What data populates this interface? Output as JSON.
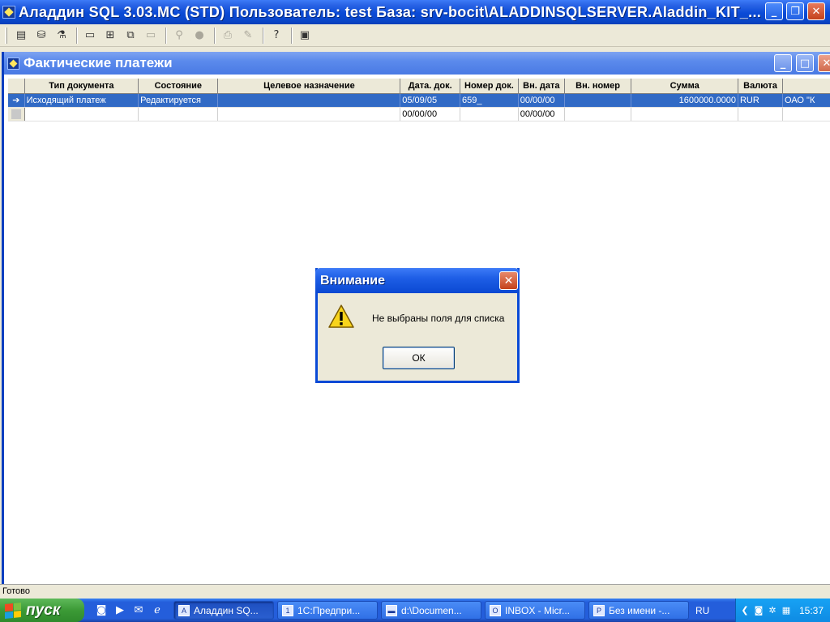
{
  "window": {
    "title": "Аладдин SQL 3.03.МС (STD)  Пользователь: test База: srv-bocit\\ALADDINSQLSERVER.Aladdin_KIT_..."
  },
  "toolbar": {
    "icons": [
      "document-list-icon",
      "database-icon",
      "filter-icon",
      "window-icon",
      "tile-icon",
      "cascade-icon",
      "window-gray-icon",
      "binoculars-icon",
      "stamp-icon",
      "printer-icon",
      "tools-icon",
      "help-icon",
      "exit-icon"
    ]
  },
  "child": {
    "title": "Фактические платежи"
  },
  "grid": {
    "columns": [
      "Тип документа",
      "Состояние",
      "Целевое назначение",
      "Дата. док.",
      "Номер док.",
      "Вн. дата",
      "Вн. номер",
      "Сумма",
      "Валюта",
      ""
    ],
    "rows": [
      {
        "type": "Исходящий платеж",
        "state": "Редактируется",
        "purpose": "",
        "doc_date": "05/09/05",
        "doc_num": "659_",
        "in_date": "00/00/00",
        "in_num": "",
        "sum": "1600000.0000",
        "currency": "RUR",
        "extra": "ОАО \"К"
      },
      {
        "type": "",
        "state": "",
        "purpose": "",
        "doc_date": "00/00/00",
        "doc_num": "",
        "in_date": "00/00/00",
        "in_num": "",
        "sum": "",
        "currency": "",
        "extra": ""
      }
    ]
  },
  "dialog": {
    "title": "Внимание",
    "message": "Не выбраны поля для списка",
    "ok": "ОК"
  },
  "status": {
    "text": "Готово"
  },
  "taskbar": {
    "start": "пуск",
    "tasks": [
      "Аладдин SQ...",
      "1С:Предпри...",
      "d:\\Documen...",
      "INBOX - Micr...",
      "Без имени -..."
    ],
    "lang": "RU",
    "clock": "15:37"
  }
}
